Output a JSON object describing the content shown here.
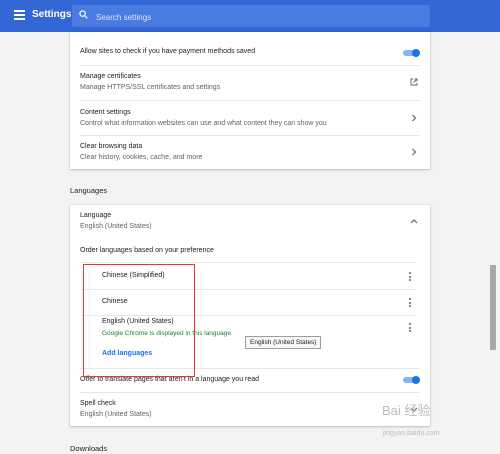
{
  "header": {
    "title": "Settings",
    "search_placeholder": "Search settings"
  },
  "privacy_card": {
    "payment_label": "Allow sites to check if you have payment methods saved",
    "payment_toggle_on": true,
    "certificates_title": "Manage certificates",
    "certificates_sub": "Manage HTTPS/SSL certificates and settings",
    "content_title": "Content settings",
    "content_sub": "Control what information websites can use and what content they can show you",
    "clear_title": "Clear browsing data",
    "clear_sub": "Clear history, cookies, cache, and more"
  },
  "languages_section": {
    "heading": "Languages",
    "language_title": "Language",
    "language_value": "English (United States)",
    "order_label": "Order languages based on your preference",
    "languages": [
      {
        "name": "Chinese (Simplified)"
      },
      {
        "name": "Chinese"
      },
      {
        "name": "English (United States)",
        "note": "Google Chrome is displayed in this language"
      }
    ],
    "add_languages": "Add languages",
    "tooltip": "English (United States)",
    "translate_label": "Offer to translate pages that aren't in a language you read",
    "translate_toggle_on": true,
    "spell_title": "Spell check",
    "spell_value": "English (United States)"
  },
  "downloads_heading": "Downloads",
  "watermark": {
    "text": "Bai 经验",
    "url": "jingyan.baidu.com"
  },
  "colors": {
    "header": "#3367d6",
    "accent": "#1a73e8",
    "green_note": "#188038",
    "highlight_box": "#e53935"
  }
}
